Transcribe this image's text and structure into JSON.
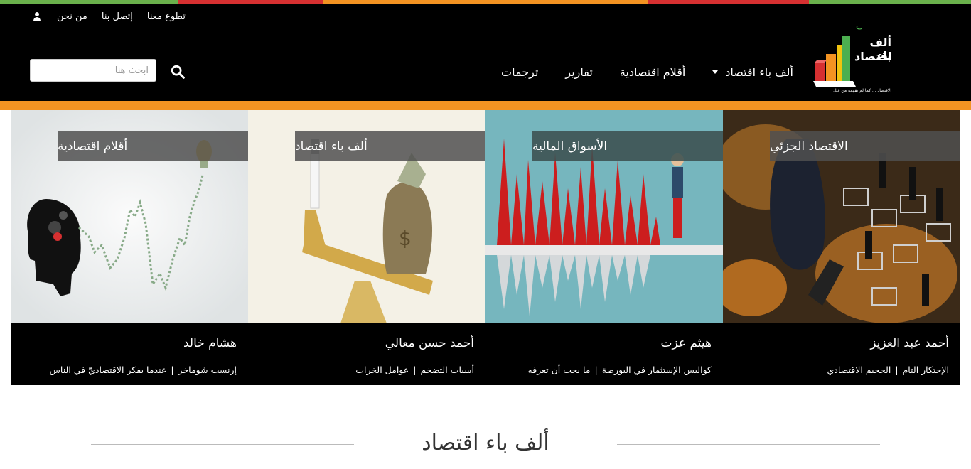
{
  "colors": {
    "strip": [
      "#6ab04c",
      "#d63031",
      "#f39322",
      "#d63031",
      "#6ab04c"
    ],
    "header_bg": "#000000",
    "accent_orange": "#f39322",
    "caption_bg": "#000000",
    "label_bg": "#505050"
  },
  "top_links": {
    "volunteer": "تطوع معنا",
    "contact": "إتصل بنا",
    "about": "من نحن",
    "user_icon": "user-icon"
  },
  "search": {
    "placeholder": "ابحث هنا",
    "icon": "search-icon"
  },
  "nav": {
    "items": [
      {
        "label": "ألف باء اقتصاد",
        "has_dropdown": true
      },
      {
        "label": "أقلام اقتصادية"
      },
      {
        "label": "تقارير"
      },
      {
        "label": "ترجمات"
      }
    ]
  },
  "logo": {
    "line1": "ألف باء",
    "line2": "اقتصاد",
    "tagline": "الاقتصاد ... كما لم تفهمه من قبل"
  },
  "cards": [
    {
      "label": "الاقتصاد الجزئي",
      "author": "أحمد عبد العزيز",
      "links": [
        "الإحتكار التام",
        "الجحيم الاقتصادي"
      ]
    },
    {
      "label": "الأسواق المالية",
      "author": "هيثم عزت",
      "links": [
        "كواليس الإستثمار في البورصة",
        "ما يجب أن تعرفه"
      ]
    },
    {
      "label": "ألف باء اقتصاد",
      "author": "أحمد حسن معالي",
      "links": [
        "أسباب التضخم",
        "عوامل الخراب"
      ]
    },
    {
      "label": "أقلام اقتصادية",
      "author": "هشام خالد",
      "links": [
        "إرنست شوماخر",
        "عندما يفكر الاقتصاديّ في الناس"
      ]
    }
  ],
  "section": {
    "title": "ألف باء اقتصاد"
  }
}
